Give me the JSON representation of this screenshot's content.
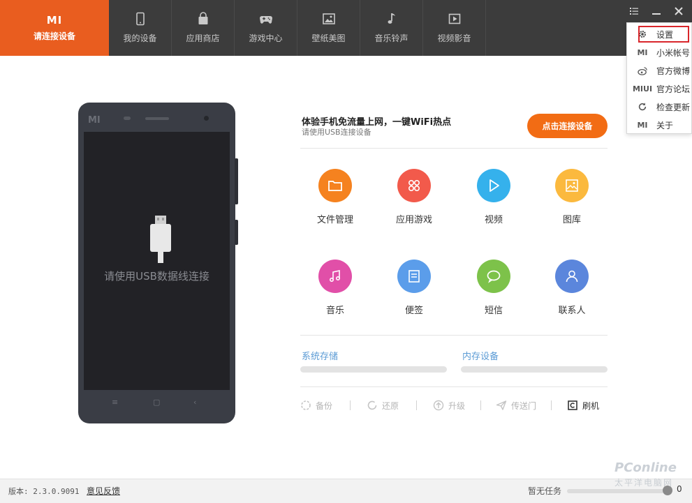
{
  "brand": {
    "logo": "MI",
    "label": "请连接设备"
  },
  "nav": {
    "tabs": [
      {
        "label": "我的设备",
        "icon": "phone-icon"
      },
      {
        "label": "应用商店",
        "icon": "shopping-bag-icon"
      },
      {
        "label": "游戏中心",
        "icon": "gamepad-icon"
      },
      {
        "label": "壁纸美图",
        "icon": "picture-icon"
      },
      {
        "label": "音乐铃声",
        "icon": "music-note-icon"
      },
      {
        "label": "视频影音",
        "icon": "video-play-icon"
      }
    ]
  },
  "menu": {
    "items": [
      {
        "label": "设置",
        "icon": "gear-icon"
      },
      {
        "label": "小米帐号",
        "icon": "mi-logo-icon",
        "icon_text": "MI"
      },
      {
        "label": "官方微博",
        "icon": "weibo-icon"
      },
      {
        "label": "官方论坛",
        "icon": "miui-logo-icon",
        "icon_text": "MIUI"
      },
      {
        "label": "检查更新",
        "icon": "refresh-icon"
      },
      {
        "label": "关于",
        "icon": "mi-logo-icon",
        "icon_text": "MI"
      }
    ],
    "highlighted": "设置"
  },
  "phone": {
    "mark": "MI",
    "prompt": "请使用USB数据线连接",
    "softkeys": [
      "≡",
      "▢",
      "‹"
    ]
  },
  "promo": {
    "title": "体验手机免流量上网，一键WiFi热点",
    "subtitle": "请使用USB连接设备",
    "button": "点击连接设备"
  },
  "features": [
    {
      "label": "文件管理",
      "icon": "folder-icon",
      "color": "#f5821f"
    },
    {
      "label": "应用游戏",
      "icon": "apps-grid-icon",
      "color": "#f25a4b"
    },
    {
      "label": "视频",
      "icon": "play-icon",
      "color": "#35b1ec"
    },
    {
      "label": "图库",
      "icon": "image-icon",
      "color": "#fbb93e"
    },
    {
      "label": "音乐",
      "icon": "music-icon",
      "color": "#e14fa8"
    },
    {
      "label": "便签",
      "icon": "note-icon",
      "color": "#5b9dea"
    },
    {
      "label": "短信",
      "icon": "message-icon",
      "color": "#7dc24a"
    },
    {
      "label": "联系人",
      "icon": "contact-icon",
      "color": "#5b86dc"
    }
  ],
  "storage": {
    "system": "系统存储",
    "memory": "内存设备"
  },
  "actions": [
    {
      "label": "备份",
      "icon": "backup-icon"
    },
    {
      "label": "还原",
      "icon": "restore-icon"
    },
    {
      "label": "升级",
      "icon": "upgrade-icon"
    },
    {
      "label": "传送门",
      "icon": "send-icon"
    },
    {
      "label": "刷机",
      "icon": "flash-icon"
    }
  ],
  "status": {
    "version": "版本: 2.3.0.9091",
    "feedback": "意见反馈",
    "task": "暂无任务",
    "task_count": "0"
  },
  "watermark": {
    "line1": "PConline",
    "line2": "太平洋电脑网"
  }
}
